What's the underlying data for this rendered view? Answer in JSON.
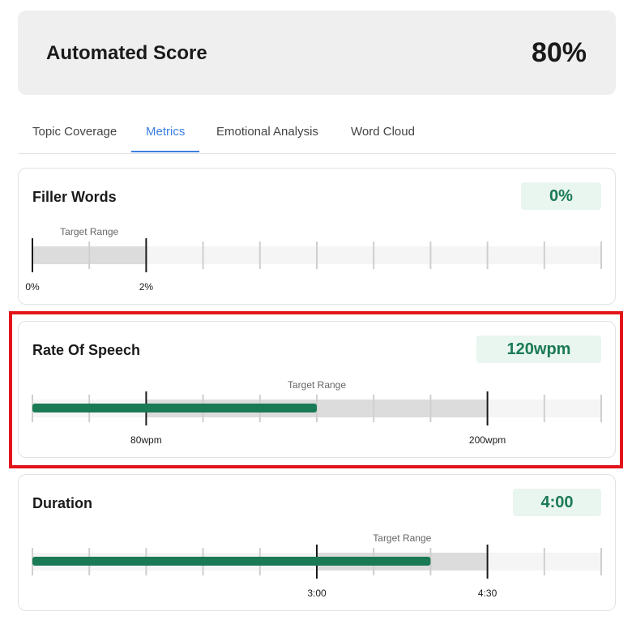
{
  "score": {
    "title": "Automated Score",
    "value": "80%"
  },
  "tabs": [
    {
      "label": "Topic Coverage",
      "active": false
    },
    {
      "label": "Metrics",
      "active": true
    },
    {
      "label": "Emotional Analysis",
      "active": false
    },
    {
      "label": "Word Cloud",
      "active": false
    }
  ],
  "metrics": [
    {
      "title": "Filler Words",
      "badge": "0%",
      "target_label": "Target Range",
      "scale_max": 10,
      "target_min": 0,
      "target_max": 2,
      "value_fraction": 0,
      "tick_labels": [
        {
          "pos": 0,
          "text": "0%"
        },
        {
          "pos": 2,
          "text": "2%"
        }
      ]
    },
    {
      "title": "Rate Of Speech",
      "badge": "120wpm",
      "target_label": "Target Range",
      "scale_max": 10,
      "target_min": 2,
      "target_max": 8,
      "value_fraction": 0.5,
      "tick_labels": [
        {
          "pos": 2,
          "text": "80wpm"
        },
        {
          "pos": 8,
          "text": "200wpm"
        }
      ]
    },
    {
      "title": "Duration",
      "badge": "4:00",
      "target_label": "Target Range",
      "scale_max": 10,
      "target_min": 5,
      "target_max": 8,
      "value_fraction": 0.7,
      "tick_labels": [
        {
          "pos": 5,
          "text": "3:00"
        },
        {
          "pos": 8,
          "text": "4:30"
        }
      ]
    }
  ],
  "colors": {
    "accent": "#3b7fe0",
    "progress": "#1a7a55",
    "badge_bg": "#e9f5ef",
    "highlight": "#e3151a"
  }
}
